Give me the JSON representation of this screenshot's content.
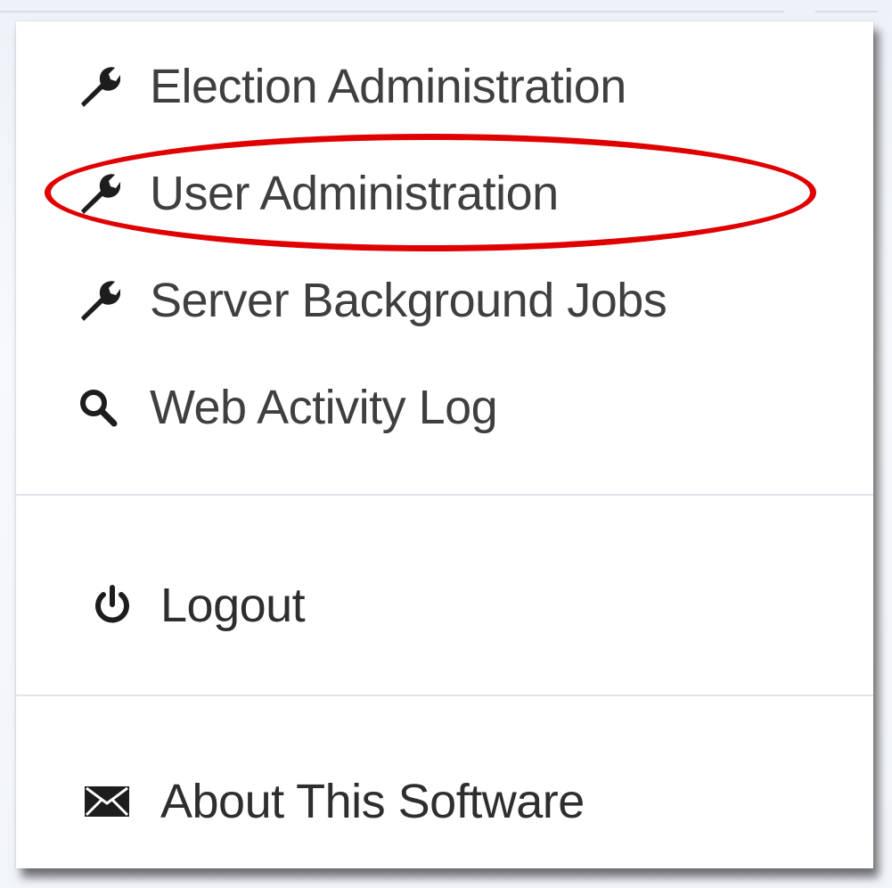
{
  "menu": {
    "items": [
      {
        "label": "Election Administration",
        "icon": "wrench-icon"
      },
      {
        "label": "User Administration",
        "icon": "wrench-icon"
      },
      {
        "label": "Server Background Jobs",
        "icon": "wrench-icon"
      },
      {
        "label": "Web Activity Log",
        "icon": "search-icon"
      }
    ],
    "logout": {
      "label": "Logout",
      "icon": "power-icon"
    },
    "about": {
      "label": "About This Software",
      "icon": "envelope-icon"
    }
  },
  "annotation": {
    "highlight_color": "#e00000",
    "highlighted_item": "User Administration"
  },
  "colors": {
    "text": "#3f3f3f",
    "divider": "#e1e4e8",
    "menu_background": "#ffffff"
  }
}
